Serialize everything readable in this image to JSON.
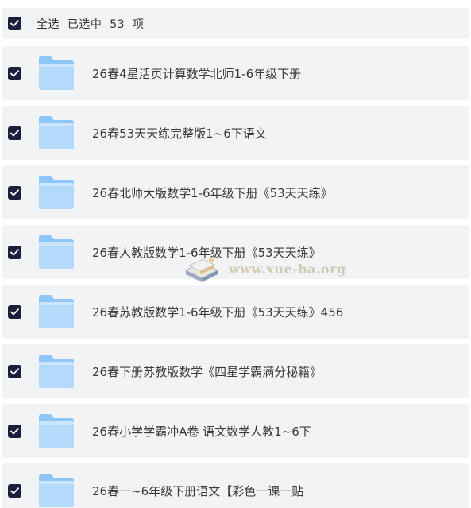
{
  "header": {
    "select_all_text": "全选  已选中  53  项",
    "checked": true
  },
  "files": [
    {
      "name": "26春4星活页计算数学北师1-6年级下册",
      "checked": true,
      "icon": "folder-icon"
    },
    {
      "name": "26春53天天练完整版1~6下语文",
      "checked": true,
      "icon": "folder-icon"
    },
    {
      "name": "26春北师大版数学1-6年级下册《53天天练》",
      "checked": true,
      "icon": "folder-icon"
    },
    {
      "name": "26春人教版数学1-6年级下册《53天天练》",
      "checked": true,
      "icon": "folder-icon"
    },
    {
      "name": "26春苏教版数学1-6年级下册《53天天练》456",
      "checked": true,
      "icon": "folder-icon"
    },
    {
      "name": "26春下册苏教版数学《四星学霸满分秘籍》",
      "checked": true,
      "icon": "folder-icon"
    },
    {
      "name": "26春小学学霸冲A卷  语文数学人教1~6下",
      "checked": true,
      "icon": "folder-icon"
    },
    {
      "name": "26春一~6年级下册语文【彩色一课一贴",
      "checked": true,
      "icon": "folder-icon"
    }
  ],
  "watermark": {
    "text": "www.xue-ba.org"
  },
  "colors": {
    "checkbox": "#1b1f3b",
    "row_background": "#f2f3f5",
    "folder_back": "#8fc6f8",
    "folder_front": "#b3d9fb"
  }
}
